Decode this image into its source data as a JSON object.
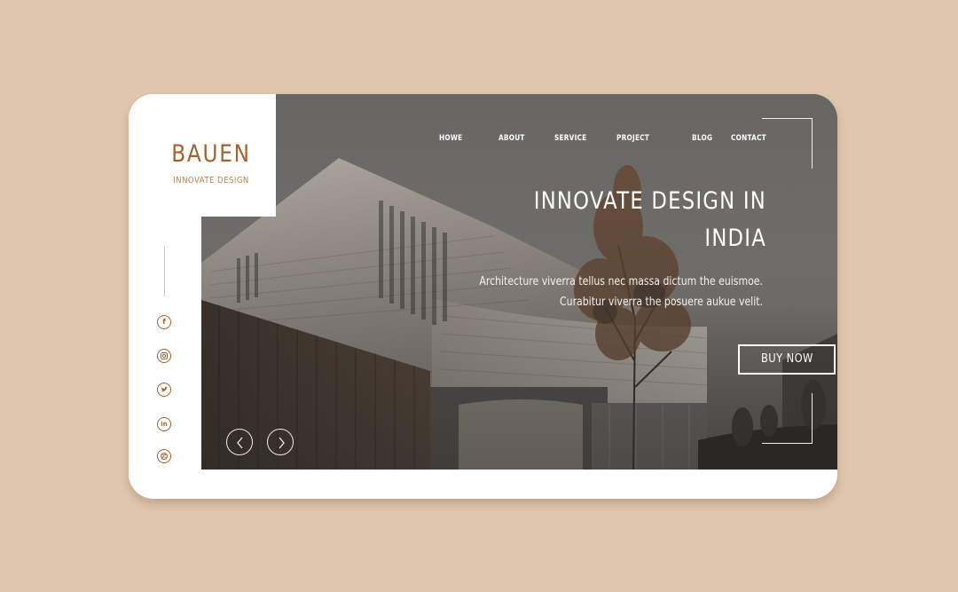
{
  "brand": {
    "title": "BAUEN",
    "subtitle": "INNOVATE DESIGN"
  },
  "nav": {
    "items": [
      "HOWE",
      "ABOUT",
      "SERVICE",
      "PROJECT",
      "BLOG",
      "CONTACT"
    ]
  },
  "hero": {
    "headline_line1": "INNOVATE DESIGN IN",
    "headline_line2": "INDIA",
    "description_line1": "Architecture viverra tellus nec massa dictum the euismoe.",
    "description_line2": "Curabitur viverra the posuere aukue velit.",
    "cta_label": "BUY NOW"
  },
  "social": {
    "icons": [
      "facebook-icon",
      "instagram-icon",
      "twitter-icon",
      "linkedin-icon",
      "dribbble-icon"
    ]
  },
  "colors": {
    "page_background": "#dfc6ad",
    "brand_accent": "#a4612a",
    "card_background": "#ffffff"
  }
}
